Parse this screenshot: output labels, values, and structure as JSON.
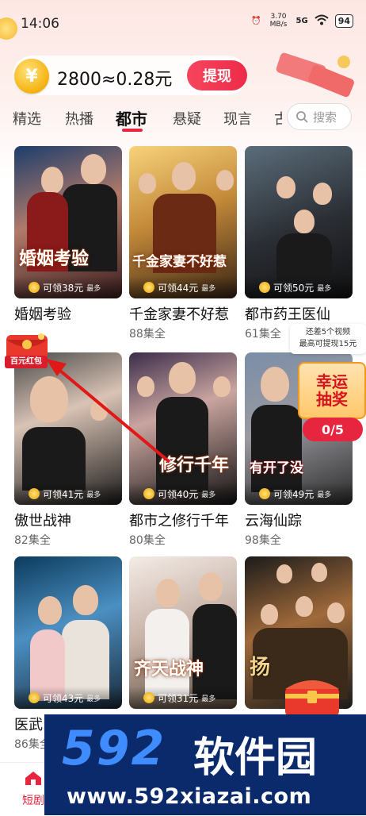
{
  "status": {
    "time": "14:06",
    "network_speed": "3.70 MB/s",
    "signal": "5G",
    "battery": "94"
  },
  "wallet": {
    "coin_symbol": "¥",
    "text": "2800≈0.28元",
    "withdraw_label": "提现"
  },
  "tabs": [
    {
      "label": "精选",
      "active": false
    },
    {
      "label": "热播",
      "active": false
    },
    {
      "label": "都市",
      "active": true
    },
    {
      "label": "悬疑",
      "active": false
    },
    {
      "label": "现言",
      "active": false
    },
    {
      "label": "古",
      "active": false
    }
  ],
  "search": {
    "placeholder": "搜索",
    "icon": "search-icon"
  },
  "dramas": [
    {
      "title": "婚姻考验",
      "episodes": "",
      "poster_text": "婚姻考验",
      "reward": "可领38元",
      "reward_suffix": "最多"
    },
    {
      "title": "千金家妻不好惹",
      "episodes": "88集全",
      "poster_text": "千金家妻不好惹",
      "reward": "可领44元",
      "reward_suffix": "最多"
    },
    {
      "title": "都市药王医仙",
      "episodes": "61集全",
      "poster_text": "",
      "reward": "可领50元",
      "reward_suffix": "最多"
    },
    {
      "title": "傲世战神",
      "episodes": "82集全",
      "poster_text": "",
      "reward": "可领41元",
      "reward_suffix": "最多"
    },
    {
      "title": "都市之修行千年",
      "episodes": "80集全",
      "poster_text": "修行千年",
      "reward": "可领40元",
      "reward_suffix": "最多"
    },
    {
      "title": "云海仙踪",
      "episodes": "98集全",
      "poster_text": "有开了没",
      "reward": "可领49元",
      "reward_suffix": "最多"
    },
    {
      "title": "医武",
      "episodes": "86集全",
      "poster_text": "",
      "reward": "可领43元",
      "reward_suffix": "最多"
    },
    {
      "title": "",
      "episodes": "",
      "poster_text": "齐天战神",
      "reward": "可领31元",
      "reward_suffix": "最多"
    },
    {
      "title": "",
      "episodes": "",
      "poster_text": "扬",
      "reward": "",
      "reward_suffix": ""
    }
  ],
  "overlays": {
    "red_packet_label": "百元红包",
    "tooltip_line1": "还差5个视频",
    "tooltip_line2": "最高可提现15元",
    "lottery_title": "幸运抽奖",
    "lottery_progress": "0/5"
  },
  "bottom_nav": {
    "home_label": "短剧"
  },
  "watermark": {
    "number": "592",
    "brand": "软件园",
    "url": "www.592xiazai.com"
  },
  "colors": {
    "accent": "#e8253f",
    "coin": "#f5b20f",
    "watermark_bg": "#0b2a6b"
  }
}
